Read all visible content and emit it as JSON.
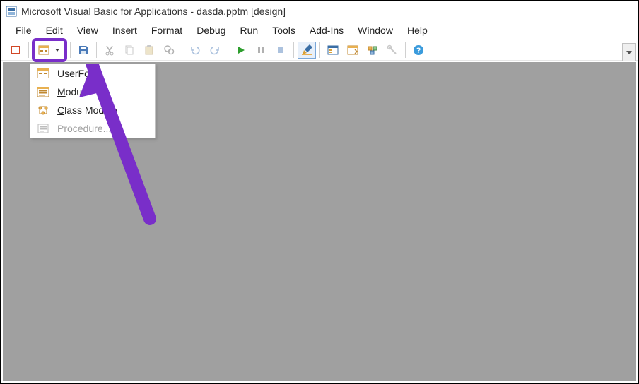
{
  "title": "Microsoft Visual Basic for Applications - dasda.pptm [design]",
  "menus": {
    "file": "ile",
    "file_u": "F",
    "edit": "dit",
    "edit_u": "E",
    "view": "iew",
    "view_u": "V",
    "insert": "nsert",
    "insert_u": "I",
    "format": "ormat",
    "format_u": "F",
    "debug": "ebug",
    "debug_u": "D",
    "run": "un",
    "run_u": "R",
    "tools": "ools",
    "tools_u": "T",
    "addins": "dd-Ins",
    "addins_u": "A",
    "window": "indow",
    "window_u": "W",
    "help": "elp",
    "help_u": "H"
  },
  "dropdown": {
    "userform": {
      "u": "U",
      "rest": "serForm"
    },
    "module": {
      "u": "M",
      "rest": "odule"
    },
    "classmodule": {
      "u": "C",
      "rest": "lass Module"
    },
    "procedure": {
      "u": "P",
      "rest": "rocedure..."
    }
  },
  "colors": {
    "highlight": "#792ec9",
    "workspace_bg": "#a0a0a0"
  }
}
